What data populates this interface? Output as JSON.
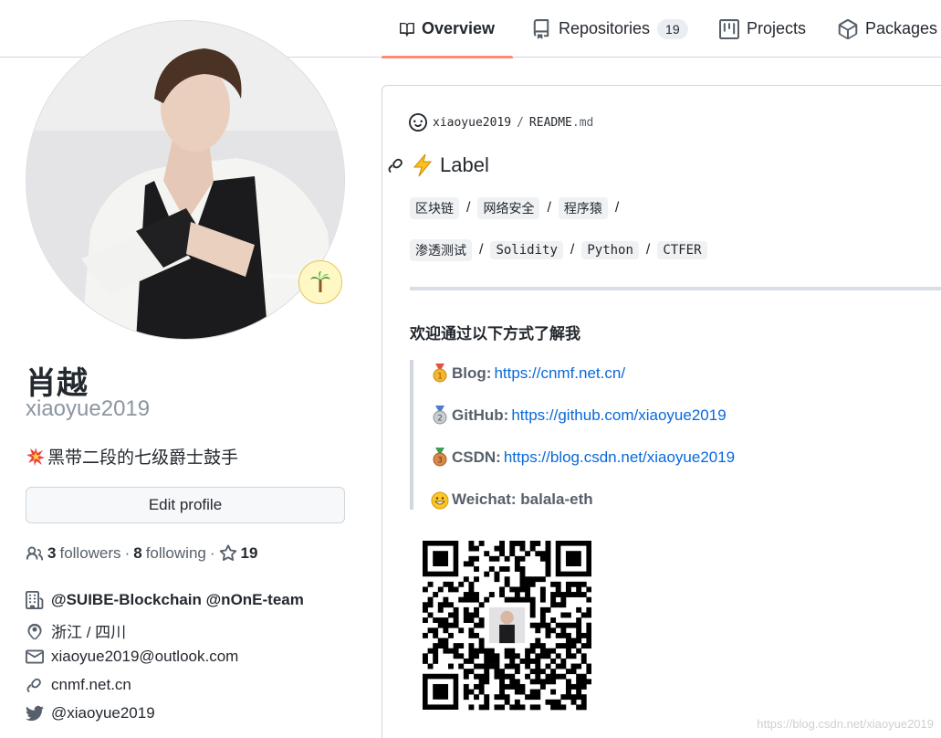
{
  "tabs": [
    {
      "label": "Overview",
      "icon": "book-icon",
      "active": true
    },
    {
      "label": "Repositories",
      "icon": "repo-icon",
      "count": "19"
    },
    {
      "label": "Projects",
      "icon": "project-icon"
    },
    {
      "label": "Packages",
      "icon": "package-icon"
    }
  ],
  "profile": {
    "name": "肖越",
    "username": "xiaoyue2019",
    "status_emoji": "palm-tree-icon",
    "bio": "黑带二段的七级爵士鼓手",
    "edit_label": "Edit profile",
    "followers_count": "3",
    "followers_label": "followers",
    "following_count": "8",
    "following_label": "following",
    "stars_count": "19",
    "org": "@SUIBE-Blockchain @nOnE-team",
    "location": "浙江 / 四川",
    "email": "xiaoyue2019@outlook.com",
    "website": "cnmf.net.cn",
    "twitter": "@xiaoyue2019"
  },
  "readme": {
    "owner": "xiaoyue2019",
    "separator": "/",
    "file": "README",
    "ext": ".md",
    "label_heading": "Label",
    "tags_row1": [
      "区块链",
      "网络安全",
      "程序猿"
    ],
    "tags_row2": [
      "渗透测试",
      "Solidity",
      "Python",
      "CTFER"
    ],
    "welcome": "欢迎通过以下方式了解我",
    "links": [
      {
        "key": "Blog:",
        "value": "https://cnmf.net.cn/"
      },
      {
        "key": "GitHub:",
        "value": "https://github.com/xiaoyue2019"
      },
      {
        "key": "CSDN:",
        "value": "https://blog.csdn.net/xiaoyue2019"
      },
      {
        "key": "Weichat: balala-eth",
        "value": ""
      }
    ]
  },
  "watermark": "https://blog.csdn.net/xiaoyue2019",
  "colors": {
    "accent": "#fd8c73",
    "link": "#0969da"
  }
}
